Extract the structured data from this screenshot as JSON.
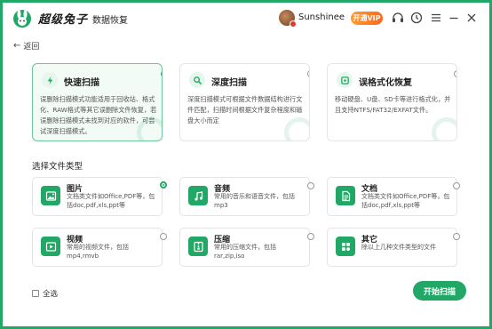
{
  "app": {
    "brand": "超级兔子",
    "brand_sub": "数据恢复",
    "username": "Sunshinee",
    "vip_label": "开通VIP",
    "accent": "#22a866"
  },
  "nav": {
    "back_label": "返回"
  },
  "scan_modes": [
    {
      "title": "快速扫描",
      "desc": "误删除扫描模式功能适用于回收站、格式化、RAW格式等其它误删除文件恢复，若误删除扫描模式未找到对应的软件，可尝试深度扫描模式。",
      "icon": "lightning-icon",
      "selected": true
    },
    {
      "title": "深度扫描",
      "desc": "深度扫描模式可根据文件数据结构进行文件匹配，扫描时间根据文件复杂程度和磁盘大小而定",
      "icon": "magnifier-icon",
      "selected": false
    },
    {
      "title": "误格式化恢复",
      "desc": "移动硬盘、U盘、SD卡等进行格式化，并且支持NTFS/FAT32/EXFAT文件。",
      "icon": "disk-icon",
      "selected": false
    }
  ],
  "section_title": "选择文件类型",
  "file_types": [
    {
      "name": "图片",
      "desc": "文档类文件如Office,PDF等，包括doc,pdf,xls,ppt等",
      "icon": "image-icon",
      "selected": true
    },
    {
      "name": "音频",
      "desc": "常用的音乐和语音文件，包括mp3",
      "icon": "music-icon",
      "selected": false
    },
    {
      "name": "文档",
      "desc": "文档类文件如Office,PDF等，包括doc,pdf,xls,ppt等",
      "icon": "document-icon",
      "selected": false
    },
    {
      "name": "视频",
      "desc": "常用的视频文件，包括mp4,rmvb",
      "icon": "video-icon",
      "selected": false
    },
    {
      "name": "压缩",
      "desc": "常用的压缩文件，包括rar,zip,iso",
      "icon": "archive-icon",
      "selected": false
    },
    {
      "name": "其它",
      "desc": "除以上几种文件类型的文件",
      "icon": "grid-icon",
      "selected": false
    }
  ],
  "footer": {
    "select_all_label": "全选",
    "start_button": "开始扫描"
  }
}
